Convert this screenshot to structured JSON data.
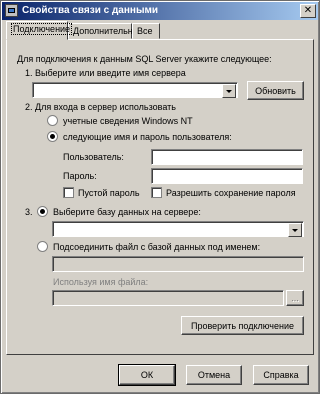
{
  "window": {
    "title": "Свойства связи с данными"
  },
  "tabs": [
    {
      "label": "Подключение"
    },
    {
      "label": "Дополнительно"
    },
    {
      "label": "Все"
    }
  ],
  "connection": {
    "intro": "Для подключения к данным SQL Server укажите следующее:",
    "step1": "1. Выберите или введите имя сервера",
    "server_value": "",
    "refresh_label": "Обновить",
    "step2": "2. Для входа в сервер использовать",
    "radio_nt": "учетные сведения Windows NT",
    "radio_user": "следующие имя и пароль пользователя:",
    "user_label": "Пользователь:",
    "user_value": "",
    "password_label": "Пароль:",
    "password_value": "",
    "empty_password": "Пустой пароль",
    "allow_save_password": "Разрешить сохранение пароля",
    "step3": "3.",
    "radio_select_db": "Выберите базу данных на сервере:",
    "database_value": "",
    "radio_attach": "Подсоединить файл с базой данных под именем:",
    "attach_value": "",
    "logical_name_label": "Используя имя файла:",
    "file_value": "",
    "browse_label": "...",
    "test_label": "Проверить подключение"
  },
  "footer": {
    "ok": "ОК",
    "cancel": "Отмена",
    "help": "Справка"
  }
}
